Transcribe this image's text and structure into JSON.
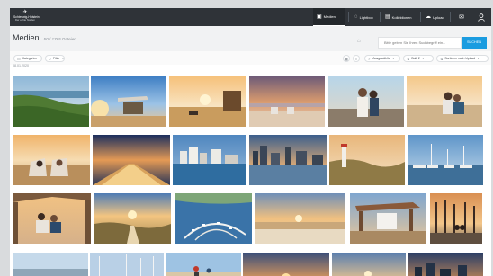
{
  "header": {
    "logo": {
      "line1": "Schleswig-Holstein",
      "line2": "Der echte Norden"
    },
    "nav": [
      {
        "label": "Medien",
        "icon": "image-icon",
        "active": true
      },
      {
        "label": "Lightbox",
        "icon": "lightbulb-icon",
        "active": false
      },
      {
        "label": "Kollektionen",
        "icon": "collection-icon",
        "active": false
      },
      {
        "label": "Upload",
        "icon": "cloud-upload-icon",
        "active": false
      }
    ],
    "icons": [
      "mail-icon",
      "user-icon"
    ]
  },
  "page": {
    "title": "Medien",
    "count": "50 / 1765 Dateien"
  },
  "search": {
    "placeholder": "Bitte geben Sie Ihren Suchbegriff ein...",
    "button": "SUCHEN"
  },
  "filters": {
    "left": [
      {
        "label": "Kategorien",
        "icon": "folder-icon"
      },
      {
        "label": "Filter",
        "icon": "filter-icon"
      }
    ],
    "right": [
      {
        "label": "Ausgewählte",
        "icon": "check-icon"
      },
      {
        "label": "Bulk 2",
        "icon": "sort-icon"
      },
      {
        "label": "Sortieren nach Upload",
        "icon": "sort-icon"
      }
    ]
  },
  "date_label": "08.01.2020",
  "images": [
    {
      "row": 1,
      "subject": "coastal cliffs and sea"
    },
    {
      "row": 1,
      "subject": "beach pavilion at sunset"
    },
    {
      "row": 1,
      "subject": "beach hut at sunset"
    },
    {
      "row": 1,
      "subject": "beach chairs at dusk"
    },
    {
      "row": 1,
      "subject": "couple on pier"
    },
    {
      "row": 1,
      "subject": "couple on beach"
    },
    {
      "row": 2,
      "subject": "couple in beach chairs"
    },
    {
      "row": 2,
      "subject": "pier at night"
    },
    {
      "row": 2,
      "subject": "seaside town skyline"
    },
    {
      "row": 2,
      "subject": "harbor city skyline"
    },
    {
      "row": 2,
      "subject": "lighthouse dunes"
    },
    {
      "row": 2,
      "subject": "marina boats"
    },
    {
      "row": 3,
      "subject": "couple in pavilion"
    },
    {
      "row": 3,
      "subject": "dune path at sunset"
    },
    {
      "row": 3,
      "subject": "aerial marina"
    },
    {
      "row": 3,
      "subject": "beach at sunset"
    },
    {
      "row": 3,
      "subject": "wooden pavilion"
    },
    {
      "row": 3,
      "subject": "couple at sunset jetty"
    },
    {
      "row": 4,
      "subject": "coastline"
    },
    {
      "row": 4,
      "subject": "harbor masts"
    },
    {
      "row": 4,
      "subject": "beach with people"
    },
    {
      "row": 4,
      "subject": "sunset over water"
    },
    {
      "row": 4,
      "subject": "evening sky"
    },
    {
      "row": 4,
      "subject": "town at dusk"
    }
  ],
  "colors": {
    "topbar": "#2f3338",
    "accent": "#1b9ce0",
    "page_bg": "#ffffff"
  }
}
